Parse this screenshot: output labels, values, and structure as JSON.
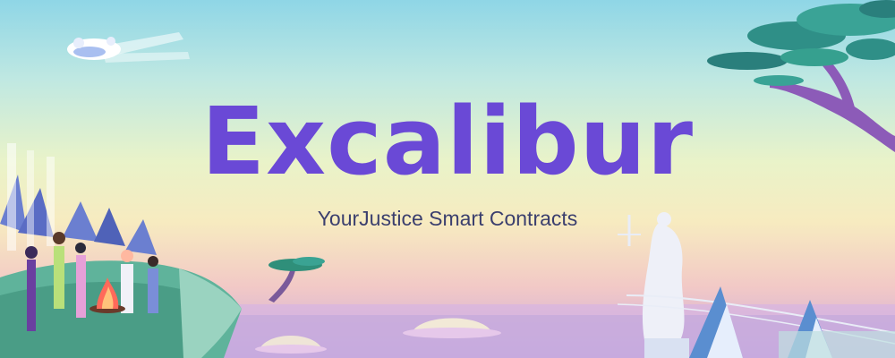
{
  "banner": {
    "title": "Excalibur",
    "subtitle": "YourJustice Smart Contracts"
  },
  "colors": {
    "title": "#6a49d6",
    "subtitle": "#3b3f6e",
    "sky_top": "#8fd6e6",
    "sky_mid": "#f7ebc0",
    "water": "#c9a9df",
    "foliage": "#2f9c8c",
    "trunk": "#8c5bb8",
    "cliff": "#5fb39b"
  },
  "icons": {
    "ship": "flying-ship-icon",
    "tree_right": "tree-icon",
    "tree_small": "tree-icon",
    "statue": "justice-statue-icon",
    "dome": "dome-icon",
    "campfire": "campfire-icon",
    "people": "people-group-icon"
  }
}
